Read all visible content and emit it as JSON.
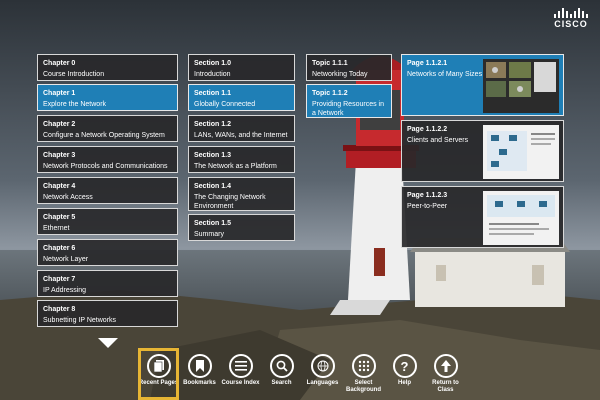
{
  "brand": {
    "name": "CISCO"
  },
  "chapters": [
    {
      "title": "Chapter 0",
      "subtitle": "Course Introduction",
      "active": false
    },
    {
      "title": "Chapter 1",
      "subtitle": "Explore the Network",
      "active": true
    },
    {
      "title": "Chapter 2",
      "subtitle": "Configure a Network Operating System",
      "active": false
    },
    {
      "title": "Chapter 3",
      "subtitle": "Network Protocols and Communications",
      "active": false
    },
    {
      "title": "Chapter 4",
      "subtitle": "Network Access",
      "active": false
    },
    {
      "title": "Chapter 5",
      "subtitle": "Ethernet",
      "active": false
    },
    {
      "title": "Chapter 6",
      "subtitle": "Network Layer",
      "active": false
    },
    {
      "title": "Chapter 7",
      "subtitle": "IP Addressing",
      "active": false
    },
    {
      "title": "Chapter 8",
      "subtitle": "Subnetting IP Networks",
      "active": false
    }
  ],
  "sections": [
    {
      "title": "Section 1.0",
      "subtitle": "Introduction",
      "active": false
    },
    {
      "title": "Section 1.1",
      "subtitle": "Globally Connected",
      "active": true
    },
    {
      "title": "Section 1.2",
      "subtitle": "LANs, WANs, and the Internet",
      "active": false
    },
    {
      "title": "Section 1.3",
      "subtitle": "The Network as a Platform",
      "active": false
    },
    {
      "title": "Section 1.4",
      "subtitle": "The Changing Network Environment",
      "active": false
    },
    {
      "title": "Section 1.5",
      "subtitle": "Summary",
      "active": false
    }
  ],
  "topics": [
    {
      "title": "Topic 1.1.1",
      "subtitle": "Networking Today",
      "active": false
    },
    {
      "title": "Topic 1.1.2",
      "subtitle": "Providing Resources in a Network",
      "active": true
    }
  ],
  "pages": [
    {
      "title": "Page 1.1.2.1",
      "subtitle": "Networks of Many Sizes",
      "active": true
    },
    {
      "title": "Page 1.1.2.2",
      "subtitle": "Clients and Servers",
      "active": false
    },
    {
      "title": "Page 1.1.2.3",
      "subtitle": "Peer-to-Peer",
      "active": false
    }
  ],
  "toolbar": {
    "items": [
      {
        "label": "Recent Pages",
        "icon": "recent-pages-icon",
        "selected": true
      },
      {
        "label": "Bookmarks",
        "icon": "bookmark-icon",
        "selected": false
      },
      {
        "label": "Course Index",
        "icon": "list-icon",
        "selected": false
      },
      {
        "label": "Search",
        "icon": "search-icon",
        "selected": false
      },
      {
        "label": "Languages",
        "icon": "globe-icon",
        "selected": false
      },
      {
        "label": "Select Background",
        "icon": "grid-icon",
        "selected": false
      },
      {
        "label": "Help",
        "icon": "help-icon",
        "selected": false
      },
      {
        "label": "Return to Class",
        "icon": "arrow-up-icon",
        "selected": false
      }
    ]
  },
  "colors": {
    "active_tile": "#1f7fb6",
    "tile_bg": "#28282a",
    "selected_outline": "#e7b534"
  }
}
